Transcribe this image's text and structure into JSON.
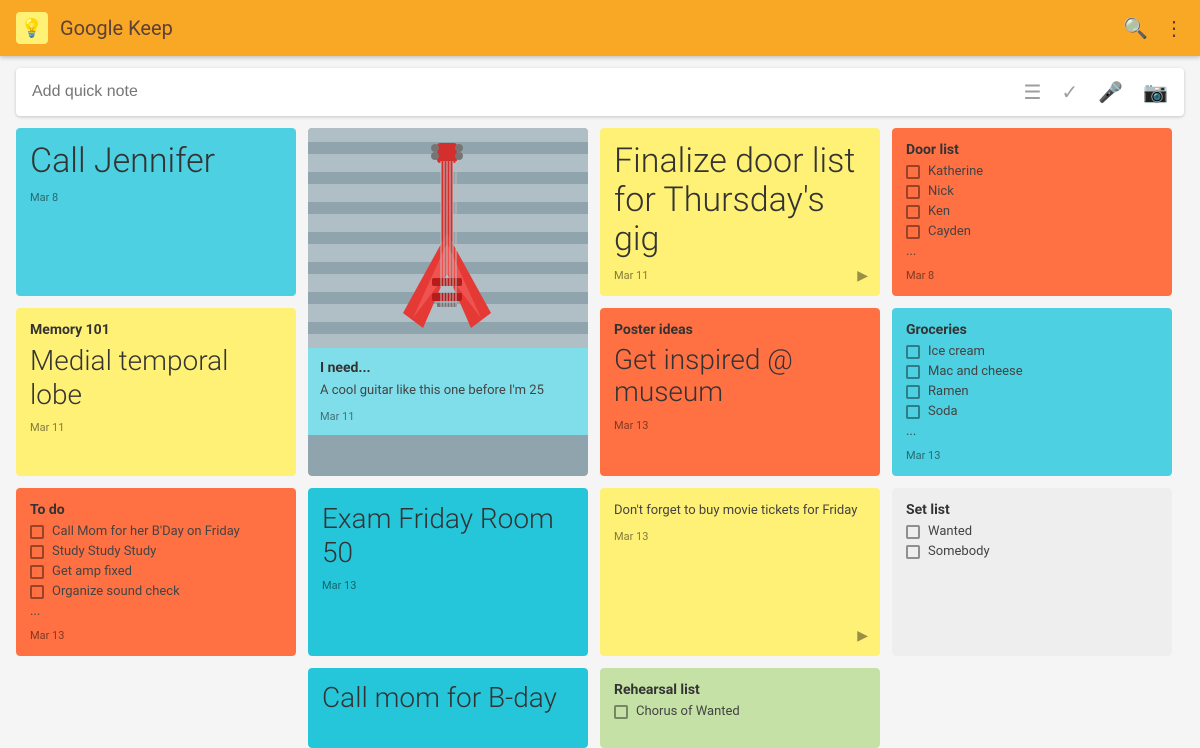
{
  "header": {
    "title": "Google Keep",
    "logo_icon": "💡"
  },
  "search": {
    "placeholder": "Add quick note"
  },
  "notes": [
    {
      "id": "call-jennifer",
      "col": 1,
      "row": 1,
      "color": "cyan",
      "big_text": "Call Jennifer",
      "date": "Mar 8",
      "type": "text"
    },
    {
      "id": "guitar-image",
      "col": 2,
      "row": 1,
      "color": "image",
      "type": "image",
      "sub_title": "I need...",
      "body": "A cool guitar like this one before I'm 25",
      "date": "Mar 11"
    },
    {
      "id": "finalize-door",
      "col": 3,
      "row": 1,
      "color": "yellow",
      "title": "",
      "big_text": "Finalize door list for Thursday's gig",
      "date": "Mar 11",
      "type": "text",
      "has_play": true
    },
    {
      "id": "door-list",
      "col": 4,
      "row": 1,
      "color": "orange",
      "title": "Door list",
      "type": "checklist",
      "items": [
        "Katherine",
        "Nick",
        "Ken",
        "Cayden",
        "..."
      ],
      "date": "Mar 8"
    },
    {
      "id": "memory-101",
      "col": 1,
      "row": 2,
      "color": "yellow",
      "title": "Memory 101",
      "medium_text": "Medial temporal lobe",
      "date": "Mar 11",
      "type": "text"
    },
    {
      "id": "poster-ideas",
      "col": 3,
      "row": 2,
      "color": "orange",
      "title": "Poster ideas",
      "big_text": "Get inspired @ museum",
      "date": "Mar 13",
      "type": "text"
    },
    {
      "id": "groceries",
      "col": 4,
      "row": 2,
      "color": "cyan",
      "title": "Groceries",
      "type": "checklist",
      "items": [
        "Ice cream",
        "Mac and cheese",
        "Ramen",
        "Soda",
        "..."
      ],
      "date": "Mar 13"
    },
    {
      "id": "to-do",
      "col": 1,
      "row": 3,
      "color": "orange",
      "title": "To do",
      "type": "checklist",
      "items": [
        "Call Mom for her B'Day on Friday",
        "Study Study Study",
        "Get amp fixed",
        "Organize sound check",
        "..."
      ],
      "date": "Mar 13"
    },
    {
      "id": "exam-friday",
      "col": 2,
      "row": 3,
      "color": "teal",
      "medium_text": "Exam Friday Room 50",
      "date": "Mar 13",
      "type": "text"
    },
    {
      "id": "movie-tickets",
      "col": 3,
      "row": 3,
      "color": "yellow",
      "body": "Don't forget to buy movie tickets for Friday",
      "date": "Mar 13",
      "type": "text",
      "has_play": true
    },
    {
      "id": "set-list",
      "col": 4,
      "row": 3,
      "color": "gray",
      "title": "Set list",
      "type": "checklist",
      "items": [
        "Wanted",
        "Somebody"
      ],
      "date": ""
    },
    {
      "id": "call-mom",
      "col": 2,
      "row": 4,
      "color": "teal",
      "big_text": "Call mom for B-day",
      "date": "",
      "type": "text"
    },
    {
      "id": "rehearsal-list",
      "col": 3,
      "row": 4,
      "color": "green",
      "title": "Rehearsal list",
      "body": "Chorus of Wanted",
      "date": "",
      "type": "checklist"
    }
  ]
}
